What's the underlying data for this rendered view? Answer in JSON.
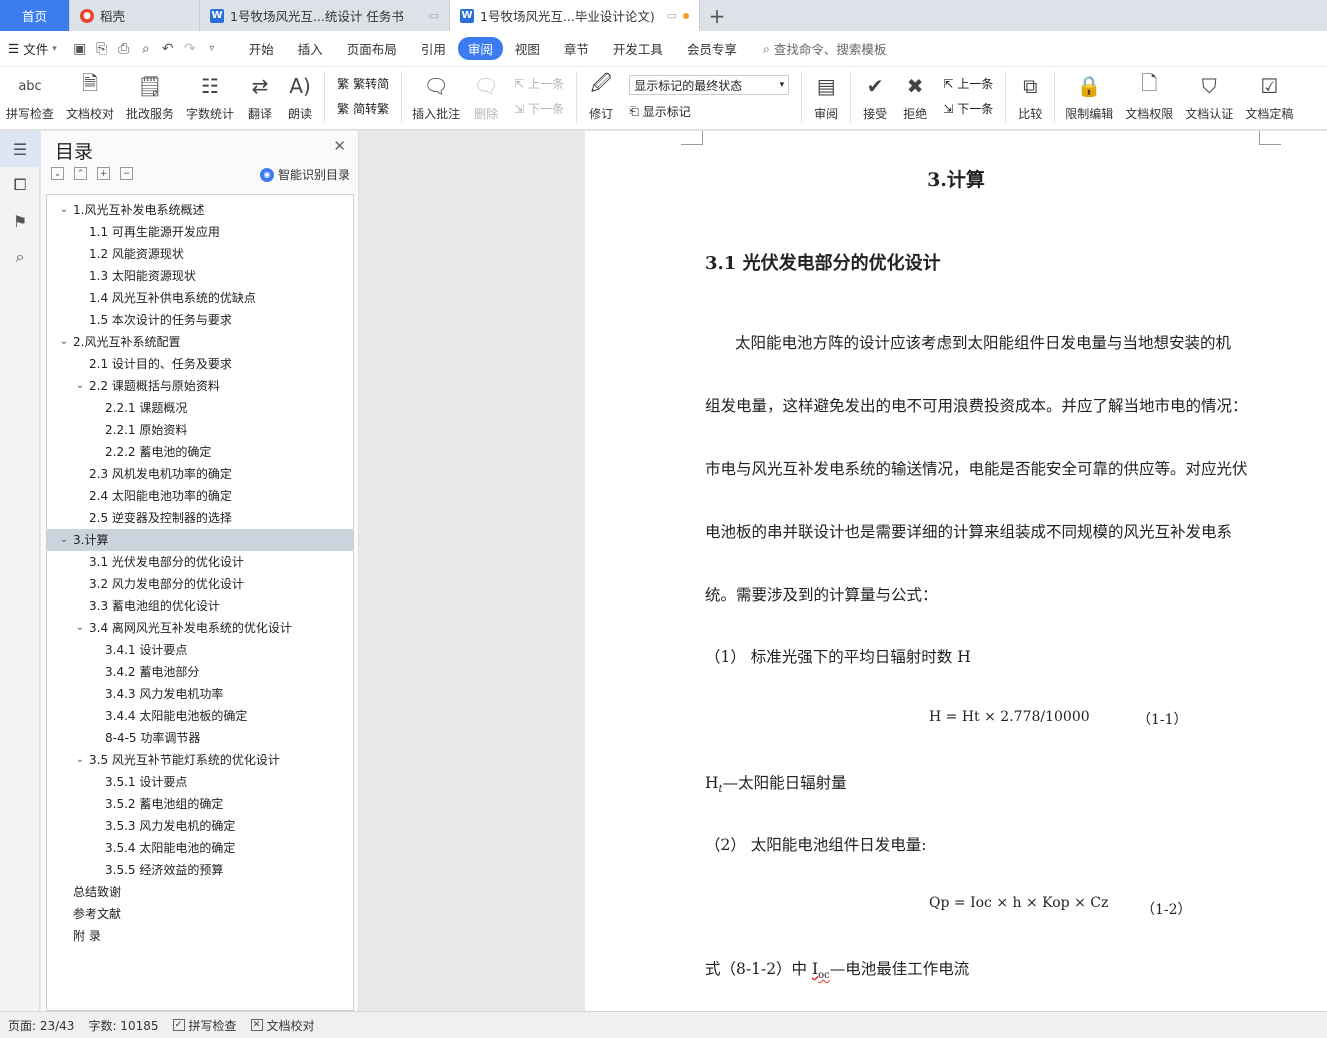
{
  "tabs": {
    "home": "首页",
    "daoke": "稻壳",
    "doc1": "1号牧场风光互...统设计 任务书",
    "doc2": "1号牧场风光互...毕业设计论文)"
  },
  "menu": {
    "file": "文件",
    "items": [
      "开始",
      "插入",
      "页面布局",
      "引用",
      "审阅",
      "视图",
      "章节",
      "开发工具",
      "会员专享"
    ],
    "search": "查找命令、搜索模板"
  },
  "ribbon": {
    "spell_check": "拼写检查",
    "doc_proof": "文档校对",
    "batch_service": "批改服务",
    "word_count": "字数统计",
    "translate": "翻译",
    "read_aloud": "朗读",
    "to_traditional": "繁转简",
    "to_simplified": "简转繁",
    "insert_comment": "插入批注",
    "delete": "删除",
    "prev": "上一条",
    "next": "下一条",
    "revise": "修订",
    "markup_select": "显示标记的最终状态",
    "show_markup": "显示标记",
    "review": "审阅",
    "accept": "接受",
    "reject": "拒绝",
    "prev2": "上一条",
    "next2": "下一条",
    "compare": "比较",
    "restrict_edit": "限制编辑",
    "doc_permission": "文档权限",
    "doc_cert": "文档认证",
    "doc_final": "文档定稿"
  },
  "toc": {
    "title": "目录",
    "smart": "智能识别目录",
    "items": [
      {
        "text": "1.风光互补发电系统概述",
        "level": 1,
        "caret": true
      },
      {
        "text": "1.1  可再生能源开发应用",
        "level": 2
      },
      {
        "text": "1.2  风能资源现状",
        "level": 2
      },
      {
        "text": "1.3  太阳能资源现状",
        "level": 2
      },
      {
        "text": "1.4  风光互补供电系统的优缺点",
        "level": 2
      },
      {
        "text": "1.5 本次设计的任务与要求",
        "level": 2
      },
      {
        "text": "2.风光互补系统配置",
        "level": 1,
        "caret": true
      },
      {
        "text": "2.1 设计目的、任务及要求",
        "level": 2
      },
      {
        "text": "2.2 课题概括与原始资料",
        "level": 2,
        "caret": true
      },
      {
        "text": "2.2.1 课题概况",
        "level": 3
      },
      {
        "text": "2.2.1 原始资料",
        "level": 3
      },
      {
        "text": "2.2.2 蓄电池的确定",
        "level": 3
      },
      {
        "text": "2.3 风机发电机功率的确定",
        "level": 2
      },
      {
        "text": "2.4 太阳能电池功率的确定",
        "level": 2
      },
      {
        "text": "2.5 逆变器及控制器的选择",
        "level": 2
      },
      {
        "text": "3.计算",
        "level": 1,
        "caret": true,
        "selected": true
      },
      {
        "text": "3.1 光伏发电部分的优化设计",
        "level": 2
      },
      {
        "text": "3.2 风力发电部分的优化设计",
        "level": 2
      },
      {
        "text": "3.3 蓄电池组的优化设计",
        "level": 2
      },
      {
        "text": "3.4  离网风光互补发电系统的优化设计",
        "level": 2,
        "caret": true
      },
      {
        "text": "3.4.1 设计要点",
        "level": 3
      },
      {
        "text": "3.4.2 蓄电池部分",
        "level": 3
      },
      {
        "text": "3.4.3 风力发电机功率",
        "level": 3
      },
      {
        "text": "3.4.4 太阳能电池板的确定",
        "level": 3
      },
      {
        "text": "8-4-5 功率调节器",
        "level": 3
      },
      {
        "text": "3.5  风光互补节能灯系统的优化设计",
        "level": 2,
        "caret": true
      },
      {
        "text": "3.5.1 设计要点",
        "level": 3
      },
      {
        "text": "3.5.2 蓄电池组的确定",
        "level": 3
      },
      {
        "text": "3.5.3 风力发电机的确定",
        "level": 3
      },
      {
        "text": "3.5.4 太阳能电池的确定",
        "level": 3
      },
      {
        "text": "3.5.5 经济效益的预算",
        "level": 3
      },
      {
        "text": "总结致谢",
        "level": 1
      },
      {
        "text": "参考文献",
        "level": 1
      },
      {
        "text": "附  录",
        "level": 1
      }
    ]
  },
  "document": {
    "heading1": "3.计算",
    "heading2": "3.1 光伏发电部分的优化设计",
    "para1": "太阳能电池方阵的设计应该考虑到太阳能组件日发电量与当地想安装的机",
    "para2": "组发电量，这样避免发出的电不可用浪费投资成本。并应了解当地市电的情况：",
    "para3": "市电与风光互补发电系统的输送情况，电能是否能安全可靠的供应等。对应光伏",
    "para4": "电池板的串并联设计也是需要详细的计算来组装成不同规模的风光互补发电系",
    "para5": "统。需要涉及到的计算量与公式：",
    "item1": "（1）  标准光强下的平均日辐射时数 H",
    "formula1": "H = Ht × 2.778/10000",
    "formula1_no": "（1-1）",
    "ht_symbol": "H",
    "ht_sub": "t",
    "ht_desc": "—太阳能日辐射量",
    "item2": "（2）  太阳能电池组件日发电量:",
    "formula2": "Qp = Ioc × h × Kop × Cz",
    "formula2_no": "（1-2）",
    "ioc_pre": "式（8-1-2）中 ",
    "ioc_symbol": "I",
    "ioc_sub": "oc",
    "ioc_desc": "—电池最佳工作电流"
  },
  "status": {
    "page": "页面: 23/43",
    "words": "字数: 10185",
    "spell": "拼写检查",
    "proof": "文档校对"
  }
}
